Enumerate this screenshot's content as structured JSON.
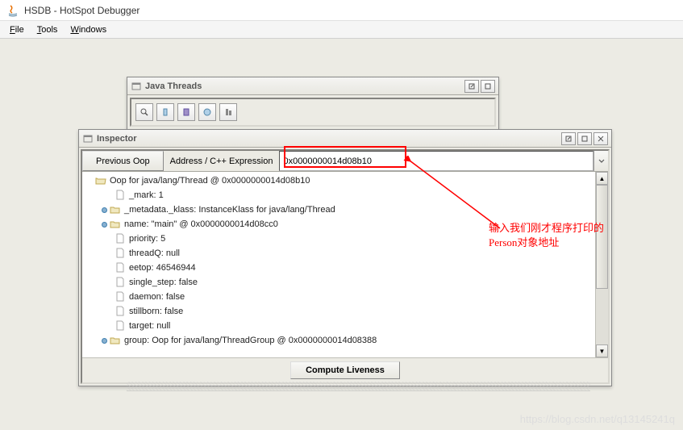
{
  "window": {
    "title": "HSDB - HotSpot Debugger"
  },
  "menubar": {
    "file": "File",
    "tools": "Tools",
    "windows": "Windows"
  },
  "threads": {
    "title": "Java Threads"
  },
  "inspector": {
    "title": "Inspector",
    "prev_btn": "Previous Oop",
    "expr_label": "Address / C++ Expression",
    "expr_value": "0x0000000014d08b10",
    "compute_btn": "Compute Liveness",
    "tree": {
      "root": "Oop for java/lang/Thread @ 0x0000000014d08b10",
      "items": [
        "_mark: 1",
        "_metadata._klass: InstanceKlass for java/lang/Thread",
        "name: \"main\" @ 0x0000000014d08cc0",
        "priority: 5",
        "threadQ: null",
        "eetop: 46546944",
        "single_step: false",
        "daemon: false",
        "stillborn: false",
        "target: null",
        "group: Oop for java/lang/ThreadGroup @ 0x0000000014d08388"
      ]
    }
  },
  "annotation": {
    "line1": "输入我们刚才程序打印的",
    "line2": "Person对象地址"
  },
  "watermark": "https://blog.csdn.net/q13145241q"
}
